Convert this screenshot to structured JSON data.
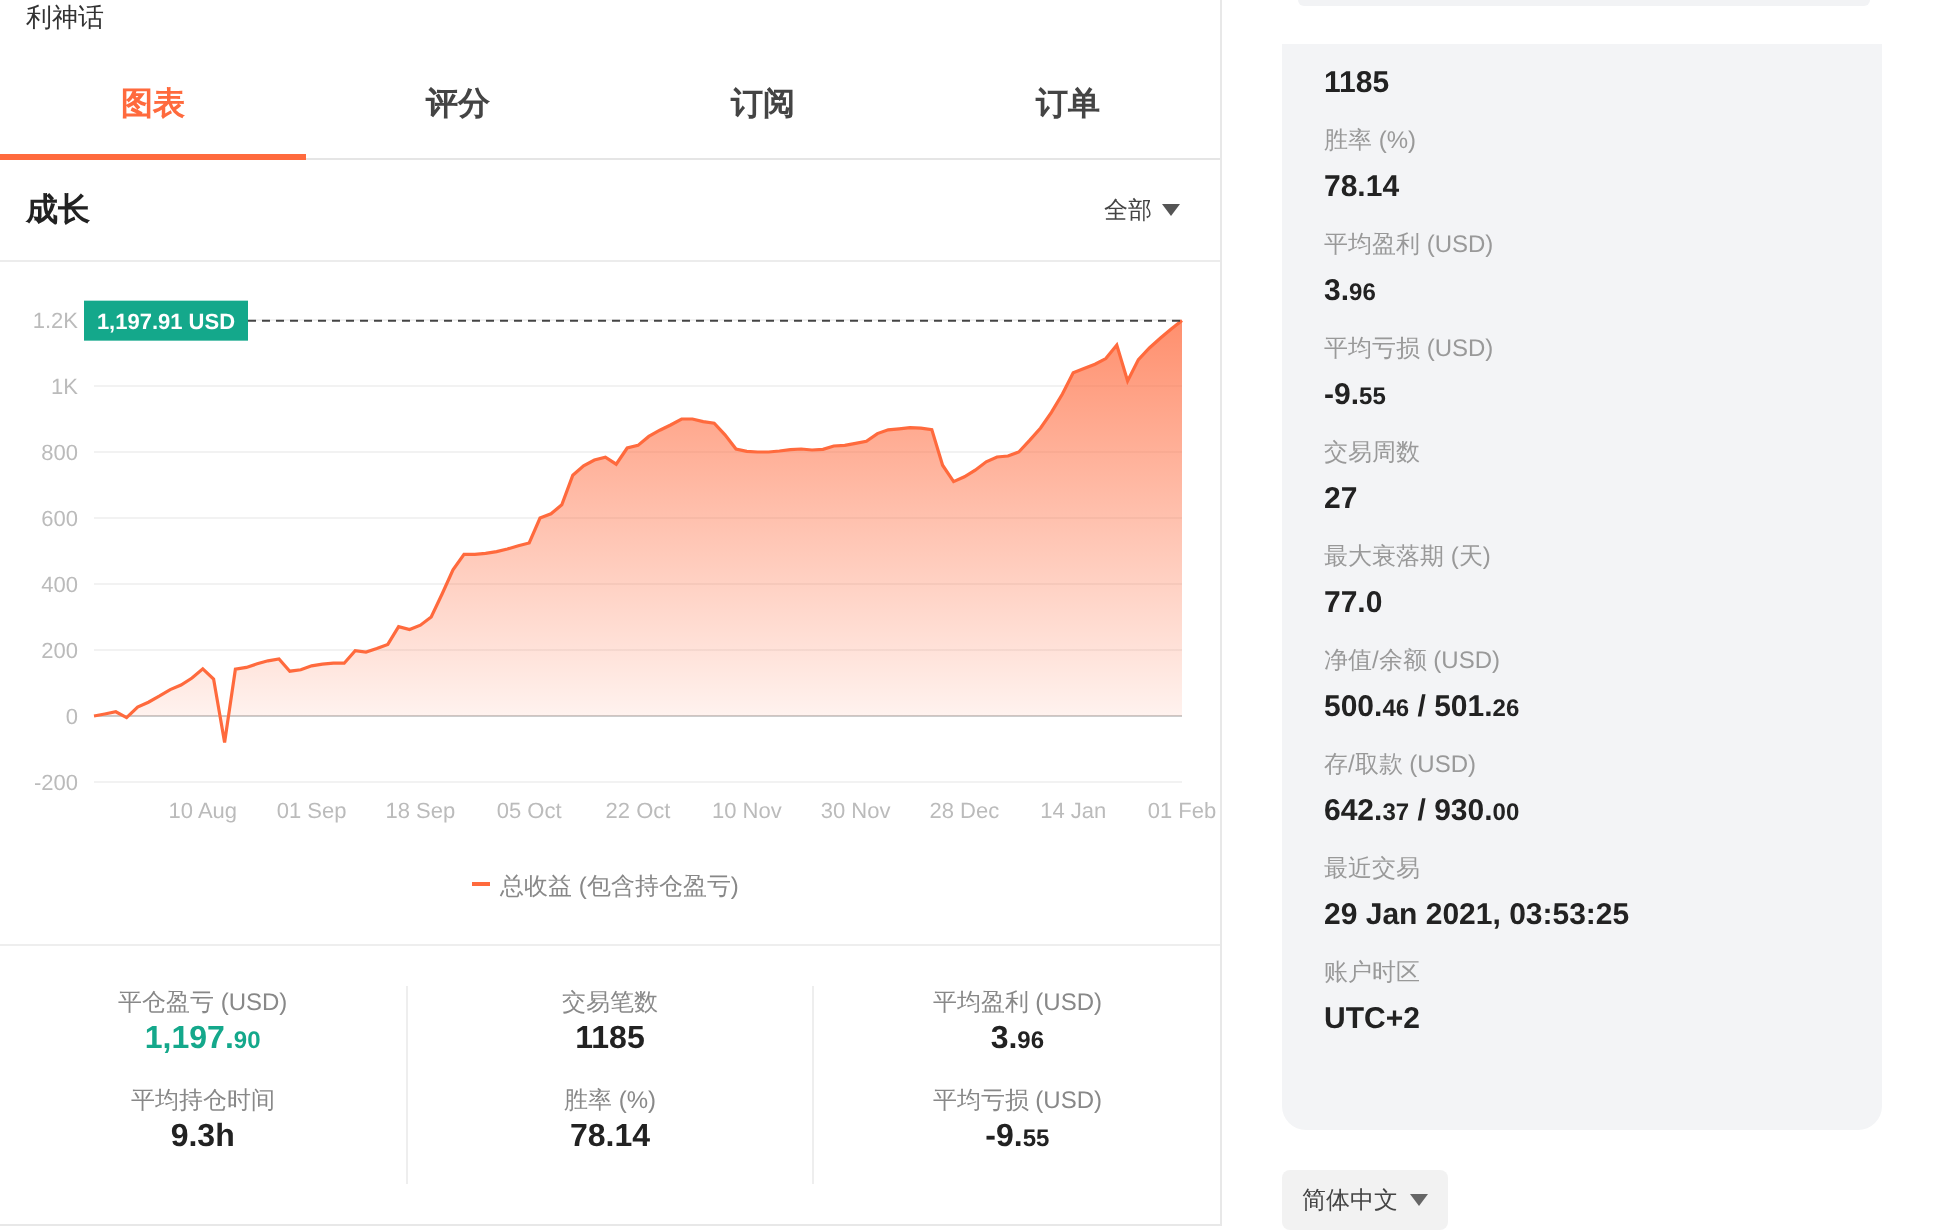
{
  "page_title": "利神话",
  "tabs": [
    {
      "label": "图表",
      "selected": true
    },
    {
      "label": "评分",
      "selected": false
    },
    {
      "label": "订阅",
      "selected": false
    },
    {
      "label": "订单",
      "selected": false
    }
  ],
  "section": {
    "title": "成长",
    "range_select": "全部"
  },
  "chart_data": {
    "type": "area",
    "grid": true,
    "ylim": [
      -200,
      1200
    ],
    "yticks": [
      {
        "value": -200,
        "label": "-200"
      },
      {
        "value": 0,
        "label": "0"
      },
      {
        "value": 200,
        "label": "200"
      },
      {
        "value": 400,
        "label": "400"
      },
      {
        "value": 600,
        "label": "600"
      },
      {
        "value": 800,
        "label": "800"
      },
      {
        "value": 1000,
        "label": "1K"
      },
      {
        "value": 1200,
        "label": "1.2K"
      }
    ],
    "categories": [
      null,
      null,
      null,
      null,
      null,
      null,
      null,
      null,
      null,
      null,
      "10 Aug",
      null,
      null,
      null,
      null,
      null,
      null,
      null,
      null,
      null,
      "01 Sep",
      null,
      null,
      null,
      null,
      null,
      null,
      null,
      null,
      null,
      "18 Sep",
      null,
      null,
      null,
      null,
      null,
      null,
      null,
      null,
      null,
      "05 Oct",
      null,
      null,
      null,
      null,
      null,
      null,
      null,
      null,
      null,
      "22 Oct",
      null,
      null,
      null,
      null,
      null,
      null,
      null,
      null,
      null,
      "10 Nov",
      null,
      null,
      null,
      null,
      null,
      null,
      null,
      null,
      null,
      "30 Nov",
      null,
      null,
      null,
      null,
      null,
      null,
      null,
      null,
      null,
      "28 Dec",
      null,
      null,
      null,
      null,
      null,
      null,
      null,
      null,
      null,
      "14 Jan",
      null,
      null,
      null,
      null,
      null,
      null,
      null,
      null,
      null,
      "01 Feb"
    ],
    "series": [
      {
        "name": "总收益 (包含持仓盈亏)",
        "color": "#ff6a3d",
        "values": [
          0,
          6,
          13,
          -5,
          27,
          42,
          60,
          80,
          94,
          115,
          143,
          112,
          -80,
          142,
          147,
          158,
          167,
          173,
          136,
          140,
          152,
          157,
          160,
          160,
          198,
          194,
          204,
          217,
          271,
          262,
          275,
          300,
          370,
          443,
          490,
          490,
          493,
          498,
          506,
          516,
          524,
          600,
          613,
          640,
          730,
          758,
          776,
          784,
          763,
          812,
          820,
          847,
          866,
          882,
          900,
          900,
          892,
          887,
          852,
          809,
          802,
          800,
          800,
          803,
          807,
          809,
          806,
          808,
          818,
          820,
          826,
          833,
          856,
          867,
          870,
          874,
          872,
          868,
          760,
          710,
          725,
          745,
          770,
          785,
          788,
          800,
          835,
          873,
          920,
          976,
          1040,
          1053,
          1066,
          1083,
          1124,
          1015,
          1080,
          1115,
          1145,
          1173,
          1198
        ]
      }
    ],
    "ref_lines": [
      {
        "label": "1,197.91 USD"
      }
    ]
  },
  "summary": [
    {
      "label": "平仓盈亏 (USD)",
      "color": "#14a88b",
      "parts": [
        {
          "text": "1,197.",
          "kind": "main"
        },
        {
          "text": "90",
          "kind": "minor"
        }
      ]
    },
    {
      "label": "平均持仓时间",
      "color": "#222222",
      "parts": [
        {
          "text": "9.3h",
          "kind": "main"
        }
      ]
    },
    {
      "label": "交易笔数",
      "color": "#222222",
      "parts": [
        {
          "text": "1185",
          "kind": "main"
        }
      ]
    },
    {
      "label": "胜率 (%)",
      "color": "#222222",
      "parts": [
        {
          "text": "78.14",
          "kind": "main"
        }
      ]
    },
    {
      "label": "平均盈利 (USD)",
      "color": "#222222",
      "parts": [
        {
          "text": "3.",
          "kind": "main"
        },
        {
          "text": "96",
          "kind": "minor"
        }
      ]
    },
    {
      "label": "平均亏损 (USD)",
      "color": "#222222",
      "parts": [
        {
          "text": "-9.",
          "kind": "main"
        },
        {
          "text": "55",
          "kind": "minor"
        }
      ]
    }
  ],
  "details": [
    {
      "parts": [
        {
          "text": "1185",
          "kind": "main"
        }
      ]
    },
    {
      "label": "胜率 (%)",
      "parts": [
        {
          "text": "78.14",
          "kind": "main"
        }
      ]
    },
    {
      "label": "平均盈利 (USD)",
      "parts": [
        {
          "text": "3.",
          "kind": "main"
        },
        {
          "text": "96",
          "kind": "minor"
        }
      ]
    },
    {
      "label": "平均亏损 (USD)",
      "parts": [
        {
          "text": "-9.",
          "kind": "main"
        },
        {
          "text": "55",
          "kind": "minor"
        }
      ]
    },
    {
      "label": "交易周数",
      "parts": [
        {
          "text": "27",
          "kind": "main"
        }
      ]
    },
    {
      "label": "最大衰落期 (天)",
      "parts": [
        {
          "text": "77.0",
          "kind": "main"
        }
      ]
    },
    {
      "label": "净值/余额 (USD)",
      "parts": [
        {
          "text": "500.",
          "kind": "main"
        },
        {
          "text": "46",
          "kind": "minor"
        },
        {
          "text": " / 501.",
          "kind": "main"
        },
        {
          "text": "26",
          "kind": "minor"
        }
      ]
    },
    {
      "label": "存/取款 (USD)",
      "parts": [
        {
          "text": "642.",
          "kind": "main"
        },
        {
          "text": "37",
          "kind": "minor"
        },
        {
          "text": " / 930.",
          "kind": "main"
        },
        {
          "text": "00",
          "kind": "minor"
        }
      ]
    },
    {
      "label": "最近交易",
      "parts": [
        {
          "text": "29 Jan 2021, 03:53:25",
          "kind": "main"
        }
      ]
    },
    {
      "label": "账户时区",
      "parts": [
        {
          "text": "UTC+2",
          "kind": "main"
        }
      ]
    }
  ],
  "language_select": "简体中文"
}
